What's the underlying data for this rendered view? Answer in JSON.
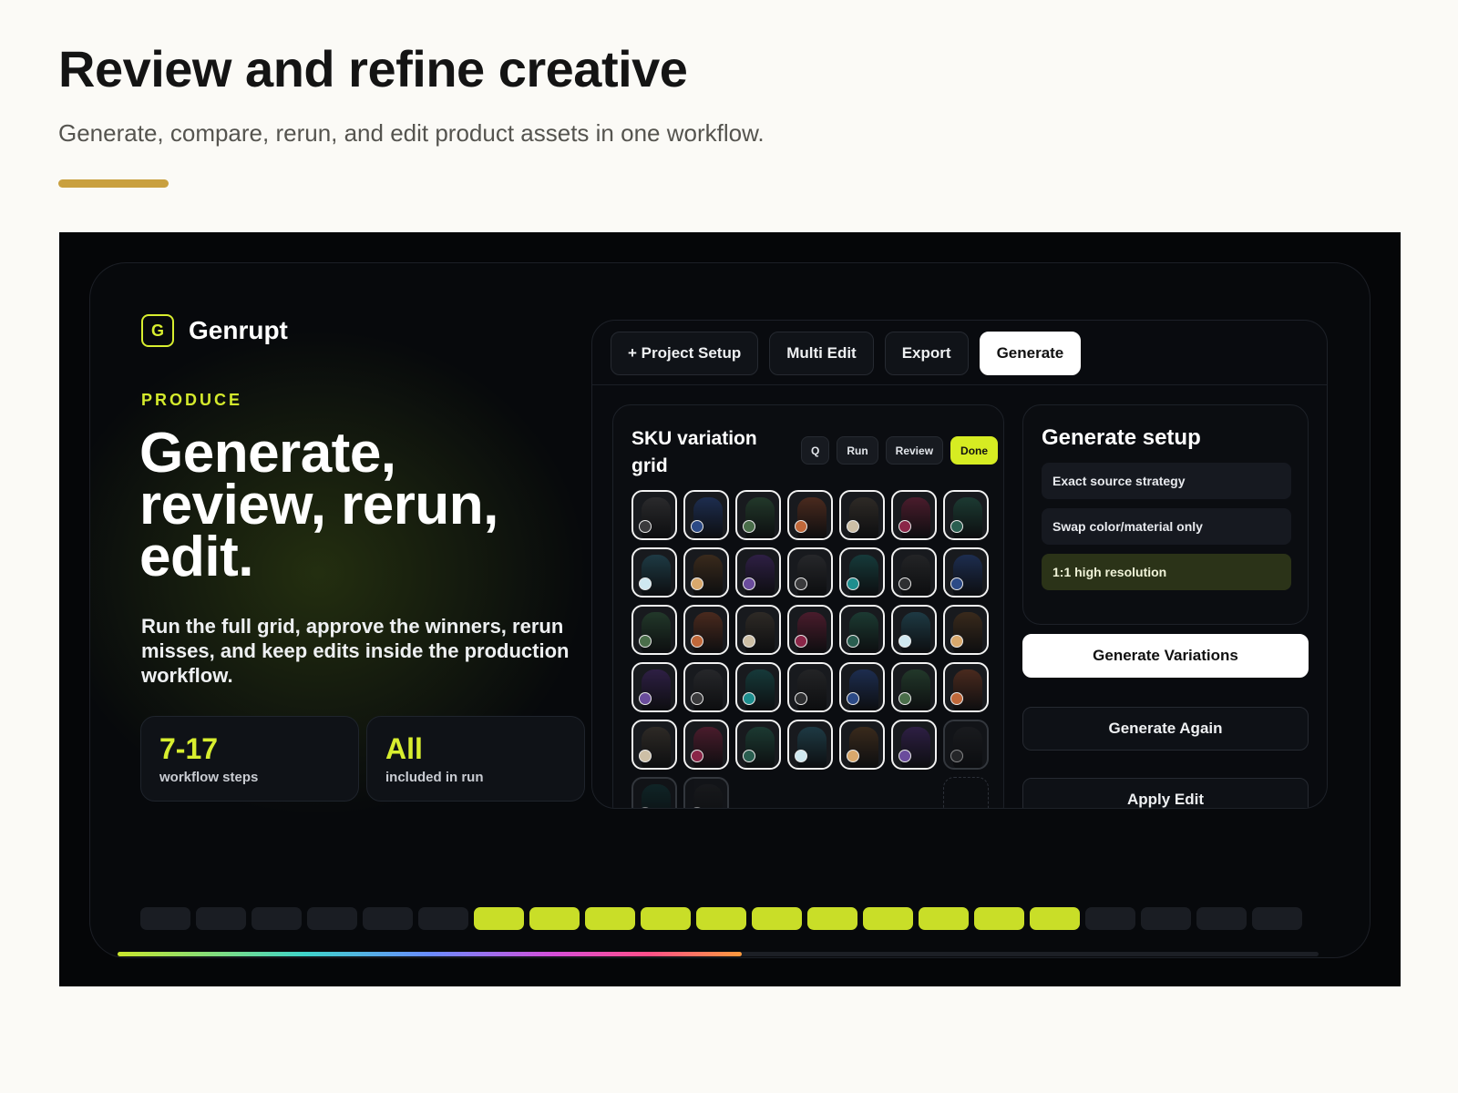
{
  "page": {
    "title": "Review and refine creative",
    "subtitle": "Generate, compare, rerun, and edit product assets in one workflow.",
    "accent_color": "#c9a03f"
  },
  "app": {
    "brand": {
      "mark": "G",
      "name": "Genrupt",
      "accent": "#d8ee2f"
    },
    "eyebrow": "PRODUCE",
    "hero_title": "Generate, review, rerun, edit.",
    "hero_description": "Run the full grid, approve the winners, rerun misses, and keep edits inside the production workflow.",
    "stats": [
      {
        "value": "7-17",
        "label": "workflow steps"
      },
      {
        "value": "All",
        "label": "included in run"
      }
    ],
    "tabs": [
      {
        "label": "+ Project Setup",
        "active": false
      },
      {
        "label": "Multi Edit",
        "active": false
      },
      {
        "label": "Export",
        "active": false
      },
      {
        "label": "Generate",
        "active": true
      }
    ],
    "sku_panel": {
      "title": "SKU variation grid",
      "chips": [
        {
          "label": "Q",
          "icon": "search-icon"
        },
        {
          "label": "Run"
        },
        {
          "label": "Review"
        },
        {
          "label": "Done",
          "active": true
        }
      ],
      "variations": [
        {
          "garment": "#2a2a2c",
          "swatch": "#3a3a3c"
        },
        {
          "garment": "#1d2d4f",
          "swatch": "#2c4a86"
        },
        {
          "garment": "#22382a",
          "swatch": "#4a6e4a"
        },
        {
          "garment": "#4a2a1e",
          "swatch": "#c0683a"
        },
        {
          "garment": "#2e2a26",
          "swatch": "#cdbfa6"
        },
        {
          "garment": "#4a1c2c",
          "swatch": "#8a2648"
        },
        {
          "garment": "#1c3a32",
          "swatch": "#2a5e50"
        },
        {
          "garment": "#1e3a44",
          "swatch": "#cfe8f0"
        },
        {
          "garment": "#3a2a1c",
          "swatch": "#d9a86c"
        },
        {
          "garment": "#2e1f44",
          "swatch": "#6a4c9c"
        },
        {
          "garment": "#26272a",
          "swatch": "#3a3a3c"
        },
        {
          "garment": "#163a3a",
          "swatch": "#1e8e8e"
        },
        {
          "garment": "#232426",
          "swatch": "#2e2f31"
        },
        {
          "garment": "#1d2d4f",
          "swatch": "#2c4a86"
        },
        {
          "garment": "#22382a",
          "swatch": "#4a6e4a"
        },
        {
          "garment": "#4a2a1e",
          "swatch": "#c0683a"
        },
        {
          "garment": "#2e2a26",
          "swatch": "#cdbfa6"
        },
        {
          "garment": "#4a1c2c",
          "swatch": "#8a2648"
        },
        {
          "garment": "#1c3a32",
          "swatch": "#2a5e50"
        },
        {
          "garment": "#1e3a44",
          "swatch": "#cfe8f0"
        },
        {
          "garment": "#3a2a1c",
          "swatch": "#d9a86c"
        },
        {
          "garment": "#2e1f44",
          "swatch": "#6a4c9c"
        },
        {
          "garment": "#26272a",
          "swatch": "#3a3a3c"
        },
        {
          "garment": "#163a3a",
          "swatch": "#1e8e8e"
        },
        {
          "garment": "#232426",
          "swatch": "#2e2f31"
        },
        {
          "garment": "#1d2d4f",
          "swatch": "#2c4a86"
        },
        {
          "garment": "#22382a",
          "swatch": "#4a6e4a"
        },
        {
          "garment": "#4a2a1e",
          "swatch": "#c0683a"
        },
        {
          "garment": "#2e2a26",
          "swatch": "#cdbfa6"
        },
        {
          "garment": "#4a1c2c",
          "swatch": "#8a2648"
        },
        {
          "garment": "#1c3a32",
          "swatch": "#2a5e50"
        },
        {
          "garment": "#1e3a44",
          "swatch": "#cfe8f0"
        },
        {
          "garment": "#3a2a1c",
          "swatch": "#d9a86c"
        },
        {
          "garment": "#2e1f44",
          "swatch": "#6a4c9c"
        },
        {
          "garment": "#26272a",
          "swatch": "#3a3a3c",
          "faded": true
        },
        {
          "garment": "#163a3a",
          "swatch": "#1e8e8e",
          "faded": true
        },
        {
          "garment": "#232426",
          "swatch": "#2e2f31",
          "faded": true
        },
        {
          "empty": true
        },
        {
          "empty": true
        },
        {
          "empty": true
        },
        {
          "empty": true
        },
        {
          "placeholder": true
        }
      ]
    },
    "setup_panel": {
      "title": "Generate setup",
      "options": [
        {
          "label": "Exact source strategy",
          "selected": false
        },
        {
          "label": "Swap color/material only",
          "selected": false
        },
        {
          "label": "1:1 high resolution",
          "selected": true
        }
      ]
    },
    "actions": {
      "generate_variations": "Generate Variations",
      "generate_again": "Generate Again",
      "apply_edit": "Apply Edit"
    },
    "step_track": {
      "total": 21,
      "active_from": 7,
      "active_to": 17
    },
    "run_progress": 0.52
  }
}
